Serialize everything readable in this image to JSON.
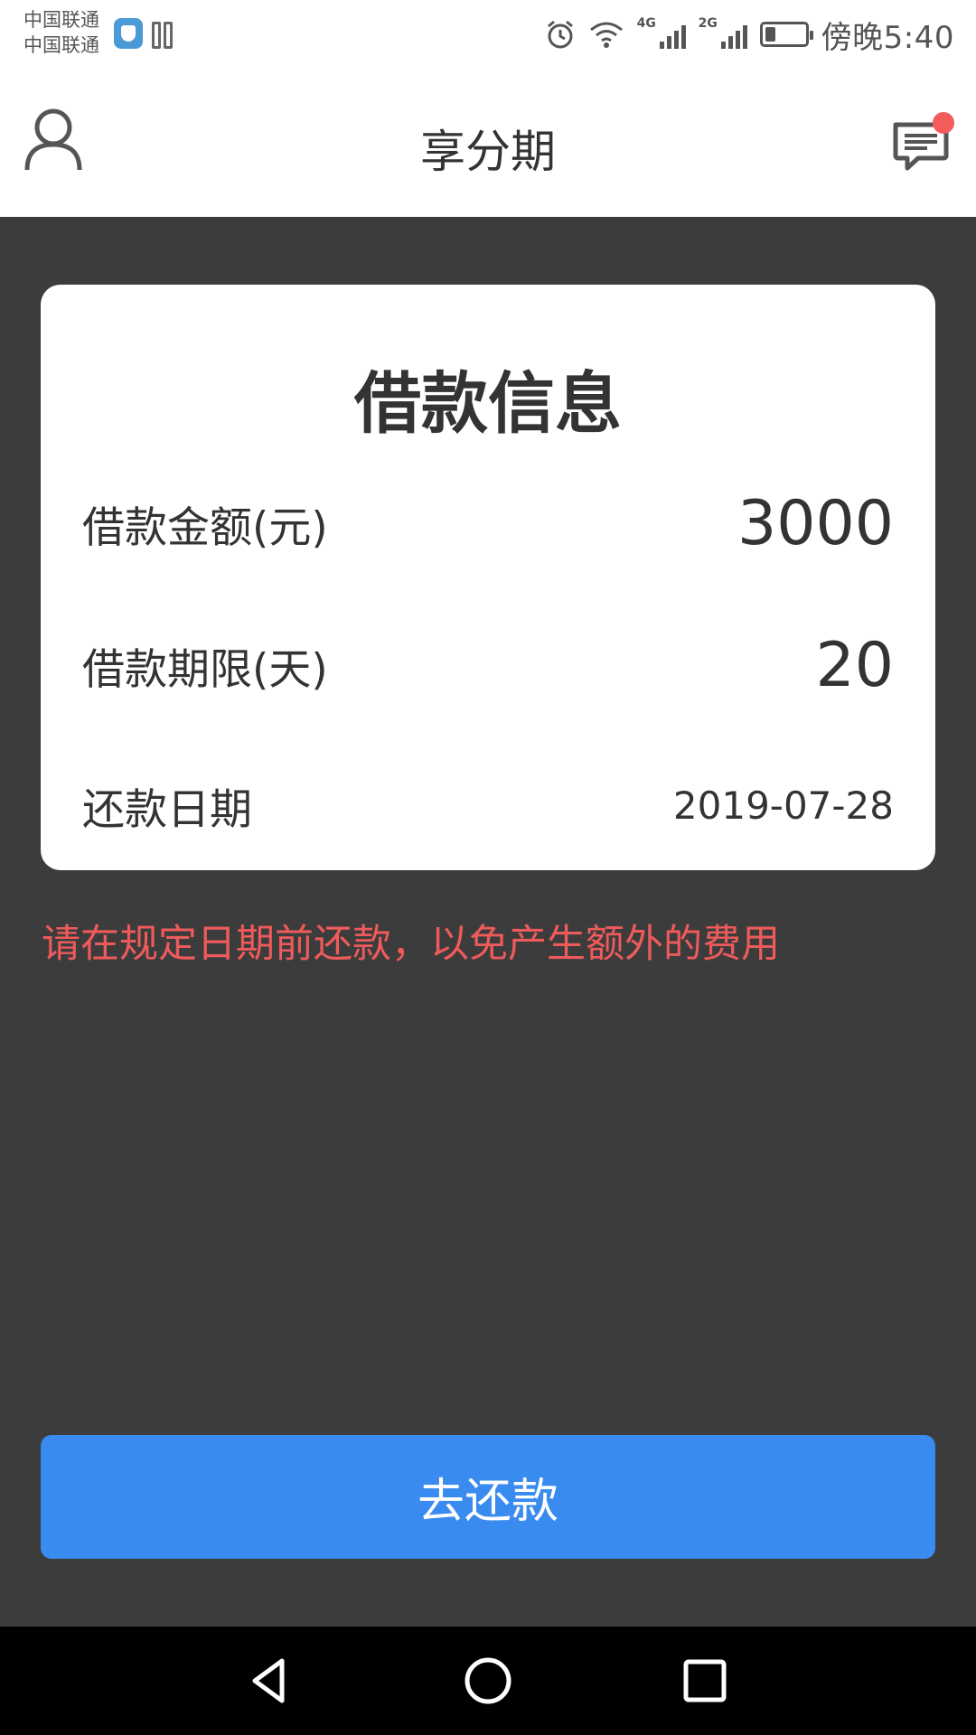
{
  "status_bar": {
    "carriers": [
      "中国联通",
      "中国联通"
    ],
    "time": "傍晚5:40",
    "network_tags": [
      "4G",
      "2G"
    ],
    "battery_level": 0.25,
    "icons": [
      "shield-app-icon",
      "book-app-icon",
      "alarm-icon",
      "wifi-icon",
      "signal-4g-icon",
      "signal-2g-icon",
      "battery-icon"
    ]
  },
  "header": {
    "title": "享分期",
    "left_icon": "user-icon",
    "right_icon": "message-icon",
    "has_notification": true
  },
  "loan_card": {
    "title": "借款信息",
    "rows": [
      {
        "label": "借款金额(元)",
        "value": "3000"
      },
      {
        "label": "借款期限(天)",
        "value": "20"
      },
      {
        "label": "还款日期",
        "value": "2019-07-28"
      }
    ]
  },
  "notice": "请在规定日期前还款，以免产生额外的费用",
  "repay_button": "去还款",
  "nav": {
    "icons": [
      "back-icon",
      "home-icon",
      "recents-icon"
    ]
  },
  "colors": {
    "background": "#3c3c3d",
    "primary": "#3a8bef",
    "warning": "#ef5a5a",
    "badge": "#f45b5b"
  }
}
